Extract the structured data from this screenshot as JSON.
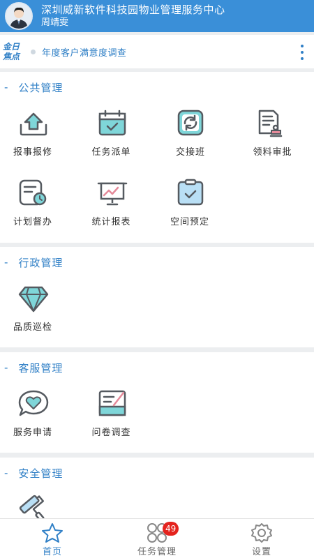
{
  "header": {
    "title": "深圳威新软件科技园物业管理服务中心",
    "user": "周靖雯"
  },
  "focus": {
    "label_line1": "金日",
    "label_line2": "焦点",
    "text": "年度客户满意度调查"
  },
  "sections": {
    "public": {
      "title": "公共管理",
      "items": [
        {
          "label": "报事报修",
          "icon": "upload-tray-icon"
        },
        {
          "label": "任务派单",
          "icon": "calendar-check-icon"
        },
        {
          "label": "交接班",
          "icon": "refresh-icon"
        },
        {
          "label": "领料审批",
          "icon": "document-stamp-icon"
        },
        {
          "label": "计划督办",
          "icon": "document-clock-icon"
        },
        {
          "label": "统计报表",
          "icon": "chart-board-icon"
        },
        {
          "label": "空间预定",
          "icon": "clipboard-check-icon"
        }
      ]
    },
    "admin": {
      "title": "行政管理",
      "items": [
        {
          "label": "品质巡检",
          "icon": "diamond-icon"
        }
      ]
    },
    "service": {
      "title": "客服管理",
      "items": [
        {
          "label": "服务申请",
          "icon": "heart-bubble-icon"
        },
        {
          "label": "问卷调查",
          "icon": "survey-board-icon"
        }
      ]
    },
    "safety": {
      "title": "安全管理",
      "items": [
        {
          "label": "",
          "icon": "paint-roller-icon"
        }
      ]
    }
  },
  "bottom_nav": {
    "home": "首页",
    "tasks": "任务管理",
    "tasks_badge": "49",
    "settings": "设置"
  },
  "colors": {
    "primary": "#3a8fd8",
    "accent_text": "#2f7fc6",
    "icon_stroke": "#555a60",
    "icon_fill": "#7fd6d9",
    "badge": "#e4231e"
  }
}
